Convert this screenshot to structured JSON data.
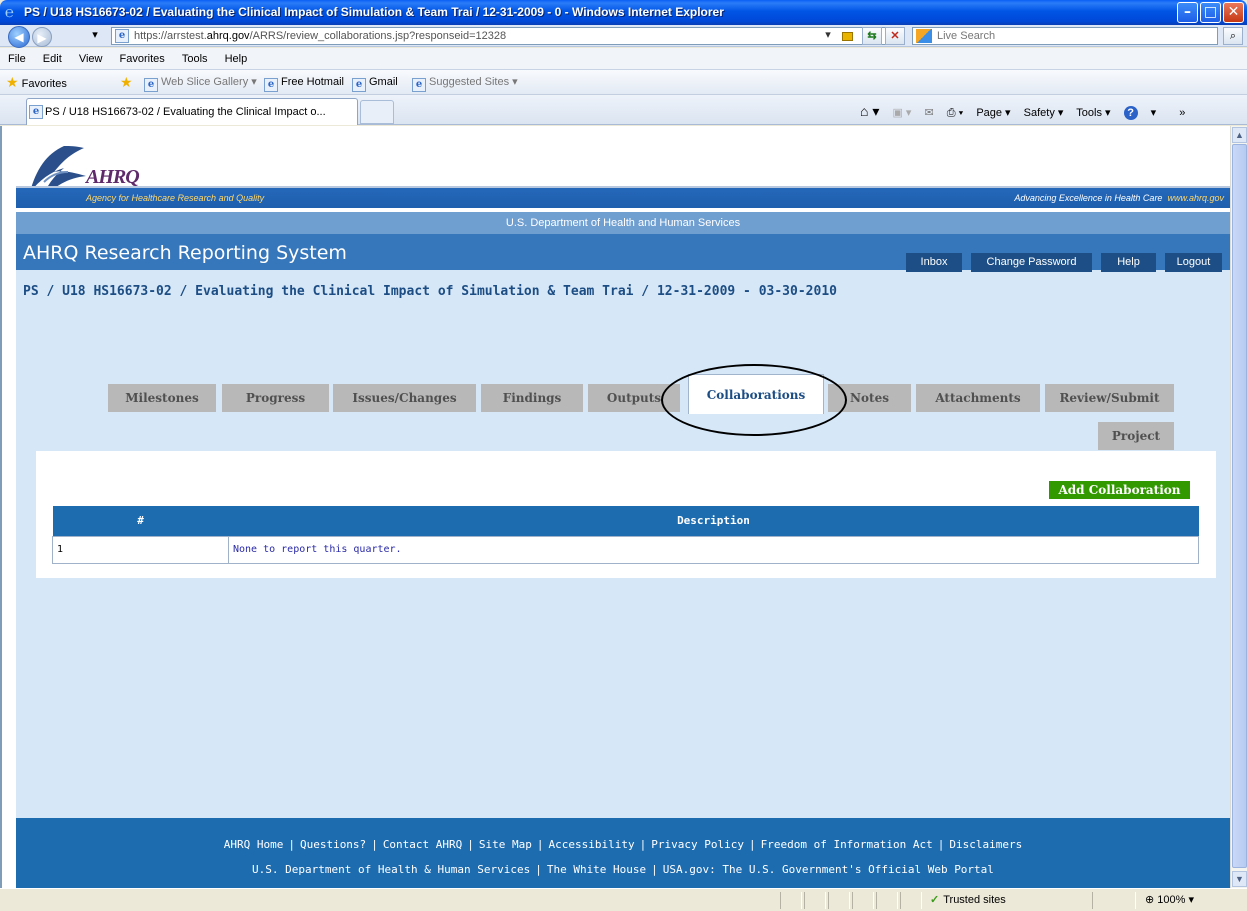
{
  "window": {
    "title": "PS / U18 HS16673-02 / Evaluating the Clinical Impact of Simulation & Team Trai / 12-31-2009 - 0 - Windows Internet Explorer",
    "min": "_",
    "max": "□",
    "close": "X"
  },
  "address": {
    "url_scheme": "https://arrstest.",
    "url_domain": "ahrq.gov",
    "url_path": "/ARRS/review_collaborations.jsp?responseid=12328",
    "search_placeholder": "Live Search"
  },
  "menu": [
    "File",
    "Edit",
    "View",
    "Favorites",
    "Tools",
    "Help"
  ],
  "favorites": {
    "label": "Favorites",
    "items": [
      "Web Slice Gallery ▾",
      "Free Hotmail",
      "Gmail",
      "Suggested Sites ▾"
    ]
  },
  "browser_tab": {
    "label": "PS / U18 HS16673-02 / Evaluating the Clinical Impact o..."
  },
  "command_bar": {
    "page": "Page ▾",
    "safety": "Safety ▾",
    "tools": "Tools ▾",
    "help": "▾"
  },
  "site": {
    "logo_text": "AHRQ",
    "agency": "Agency for Healthcare Research and Quality",
    "tagline": "Advancing Excellence in Health Care",
    "tagline_url": "www.ahrq.gov",
    "hhs": "U.S. Department of Health and Human Services",
    "system_title": "AHRQ Research Reporting System",
    "top_links": {
      "inbox": "Inbox",
      "change_password": "Change Password",
      "help": "Help",
      "logout": "Logout"
    },
    "page_title": "PS / U18 HS16673-02 / Evaluating the Clinical Impact of Simulation & Team Trai / 12-31-2009 - 03-30-2010"
  },
  "tabs": {
    "milestones": "Milestones",
    "progress": "Progress",
    "issues": "Issues/Changes",
    "findings": "Findings",
    "outputs": "Outputs",
    "collaborations": "Collaborations",
    "notes": "Notes",
    "attachments": "Attachments",
    "review": "Review/Submit",
    "project": "Project"
  },
  "collaborations": {
    "add_button": "Add Collaboration",
    "columns": [
      "#",
      "Description"
    ],
    "rows": [
      {
        "num": "1",
        "description": "None to report this quarter."
      }
    ]
  },
  "footer": {
    "line1": [
      "AHRQ Home",
      "Questions?",
      "Contact AHRQ",
      "Site Map",
      "Accessibility",
      "Privacy Policy",
      "Freedom of Information Act",
      "Disclaimers"
    ],
    "line2": [
      "U.S. Department of Health & Human Services",
      "The White House",
      "USA.gov: The U.S. Government's Official Web Portal"
    ]
  },
  "status": {
    "zone": "Trusted sites",
    "zoom": "100%"
  },
  "colors": {
    "accent": "#1e6cb0",
    "add_button": "#339900",
    "title_bar": "#0055e5"
  }
}
